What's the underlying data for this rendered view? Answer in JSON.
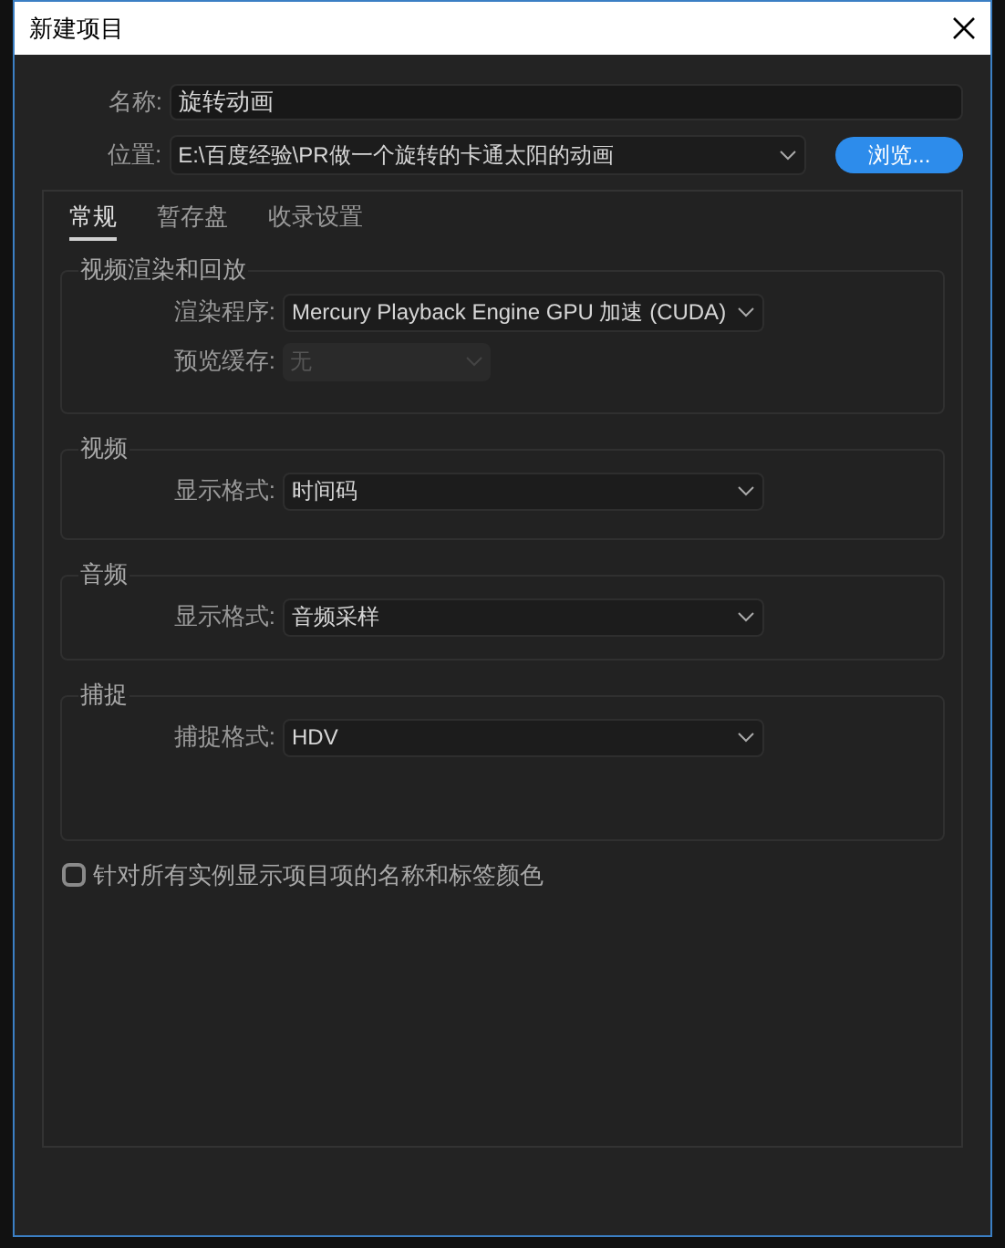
{
  "window": {
    "title": "新建项目"
  },
  "name_field": {
    "label": "名称:",
    "value": "旋转动画"
  },
  "location_field": {
    "label": "位置:",
    "value": "E:\\百度经验\\PR做一个旋转的卡通太阳的动画"
  },
  "browse_button": "浏览...",
  "tabs": [
    {
      "label": "常规",
      "selected": true
    },
    {
      "label": "暂存盘",
      "selected": false
    },
    {
      "label": "收录设置",
      "selected": false
    }
  ],
  "groups": [
    {
      "title": "视频渲染和回放",
      "fields": [
        {
          "label": "渲染程序:",
          "value": "Mercury Playback Engine GPU 加速 (CUDA)",
          "disabled": false
        },
        {
          "label": "预览缓存:",
          "value": "无",
          "disabled": true
        }
      ]
    },
    {
      "title": "视频",
      "fields": [
        {
          "label": "显示格式:",
          "value": "时间码",
          "disabled": false
        }
      ]
    },
    {
      "title": "音频",
      "fields": [
        {
          "label": "显示格式:",
          "value": "音频采样",
          "disabled": false
        }
      ]
    },
    {
      "title": "捕捉",
      "fields": [
        {
          "label": "捕捉格式:",
          "value": "HDV",
          "disabled": false
        }
      ]
    }
  ],
  "display_names_checkbox": {
    "label": "针对所有实例显示项目项的名称和标签颜色",
    "checked": false
  }
}
